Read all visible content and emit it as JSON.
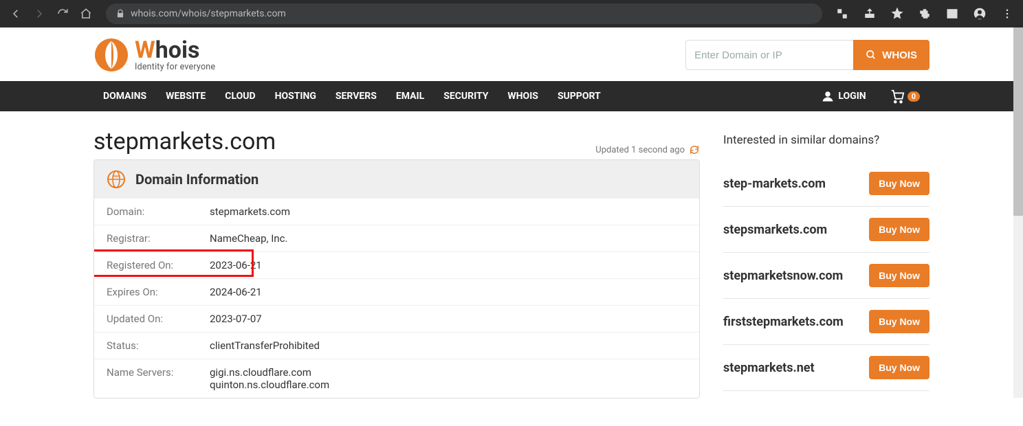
{
  "browser": {
    "url": "whois.com/whois/stepmarkets.com"
  },
  "logo": {
    "brand_w": "W",
    "brand_rest": "hois",
    "tagline": "Identity for everyone"
  },
  "search": {
    "placeholder": "Enter Domain or IP",
    "button": "WHOIS"
  },
  "nav": {
    "items": [
      "DOMAINS",
      "WEBSITE",
      "CLOUD",
      "HOSTING",
      "SERVERS",
      "EMAIL",
      "SECURITY",
      "WHOIS",
      "SUPPORT"
    ],
    "login": "LOGIN",
    "cart_count": "0"
  },
  "page": {
    "title": "stepmarkets.com",
    "updated": "Updated 1 second ago"
  },
  "panel": {
    "heading": "Domain Information",
    "rows": [
      {
        "k": "Domain:",
        "v": "stepmarkets.com"
      },
      {
        "k": "Registrar:",
        "v": "NameCheap, Inc."
      },
      {
        "k": "Registered On:",
        "v": "2023-06-21"
      },
      {
        "k": "Expires On:",
        "v": "2024-06-21"
      },
      {
        "k": "Updated On:",
        "v": "2023-07-07"
      },
      {
        "k": "Status:",
        "v": "clientTransferProhibited"
      },
      {
        "k": "Name Servers:",
        "v": "gigi.ns.cloudflare.com\nquinton.ns.cloudflare.com"
      }
    ],
    "highlight_row_index": 2
  },
  "similar": {
    "heading": "Interested in similar domains?",
    "buy_label": "Buy Now",
    "items": [
      "step-markets.com",
      "stepsmarkets.com",
      "stepmarketsnow.com",
      "firststepmarkets.com",
      "stepmarkets.net"
    ]
  }
}
